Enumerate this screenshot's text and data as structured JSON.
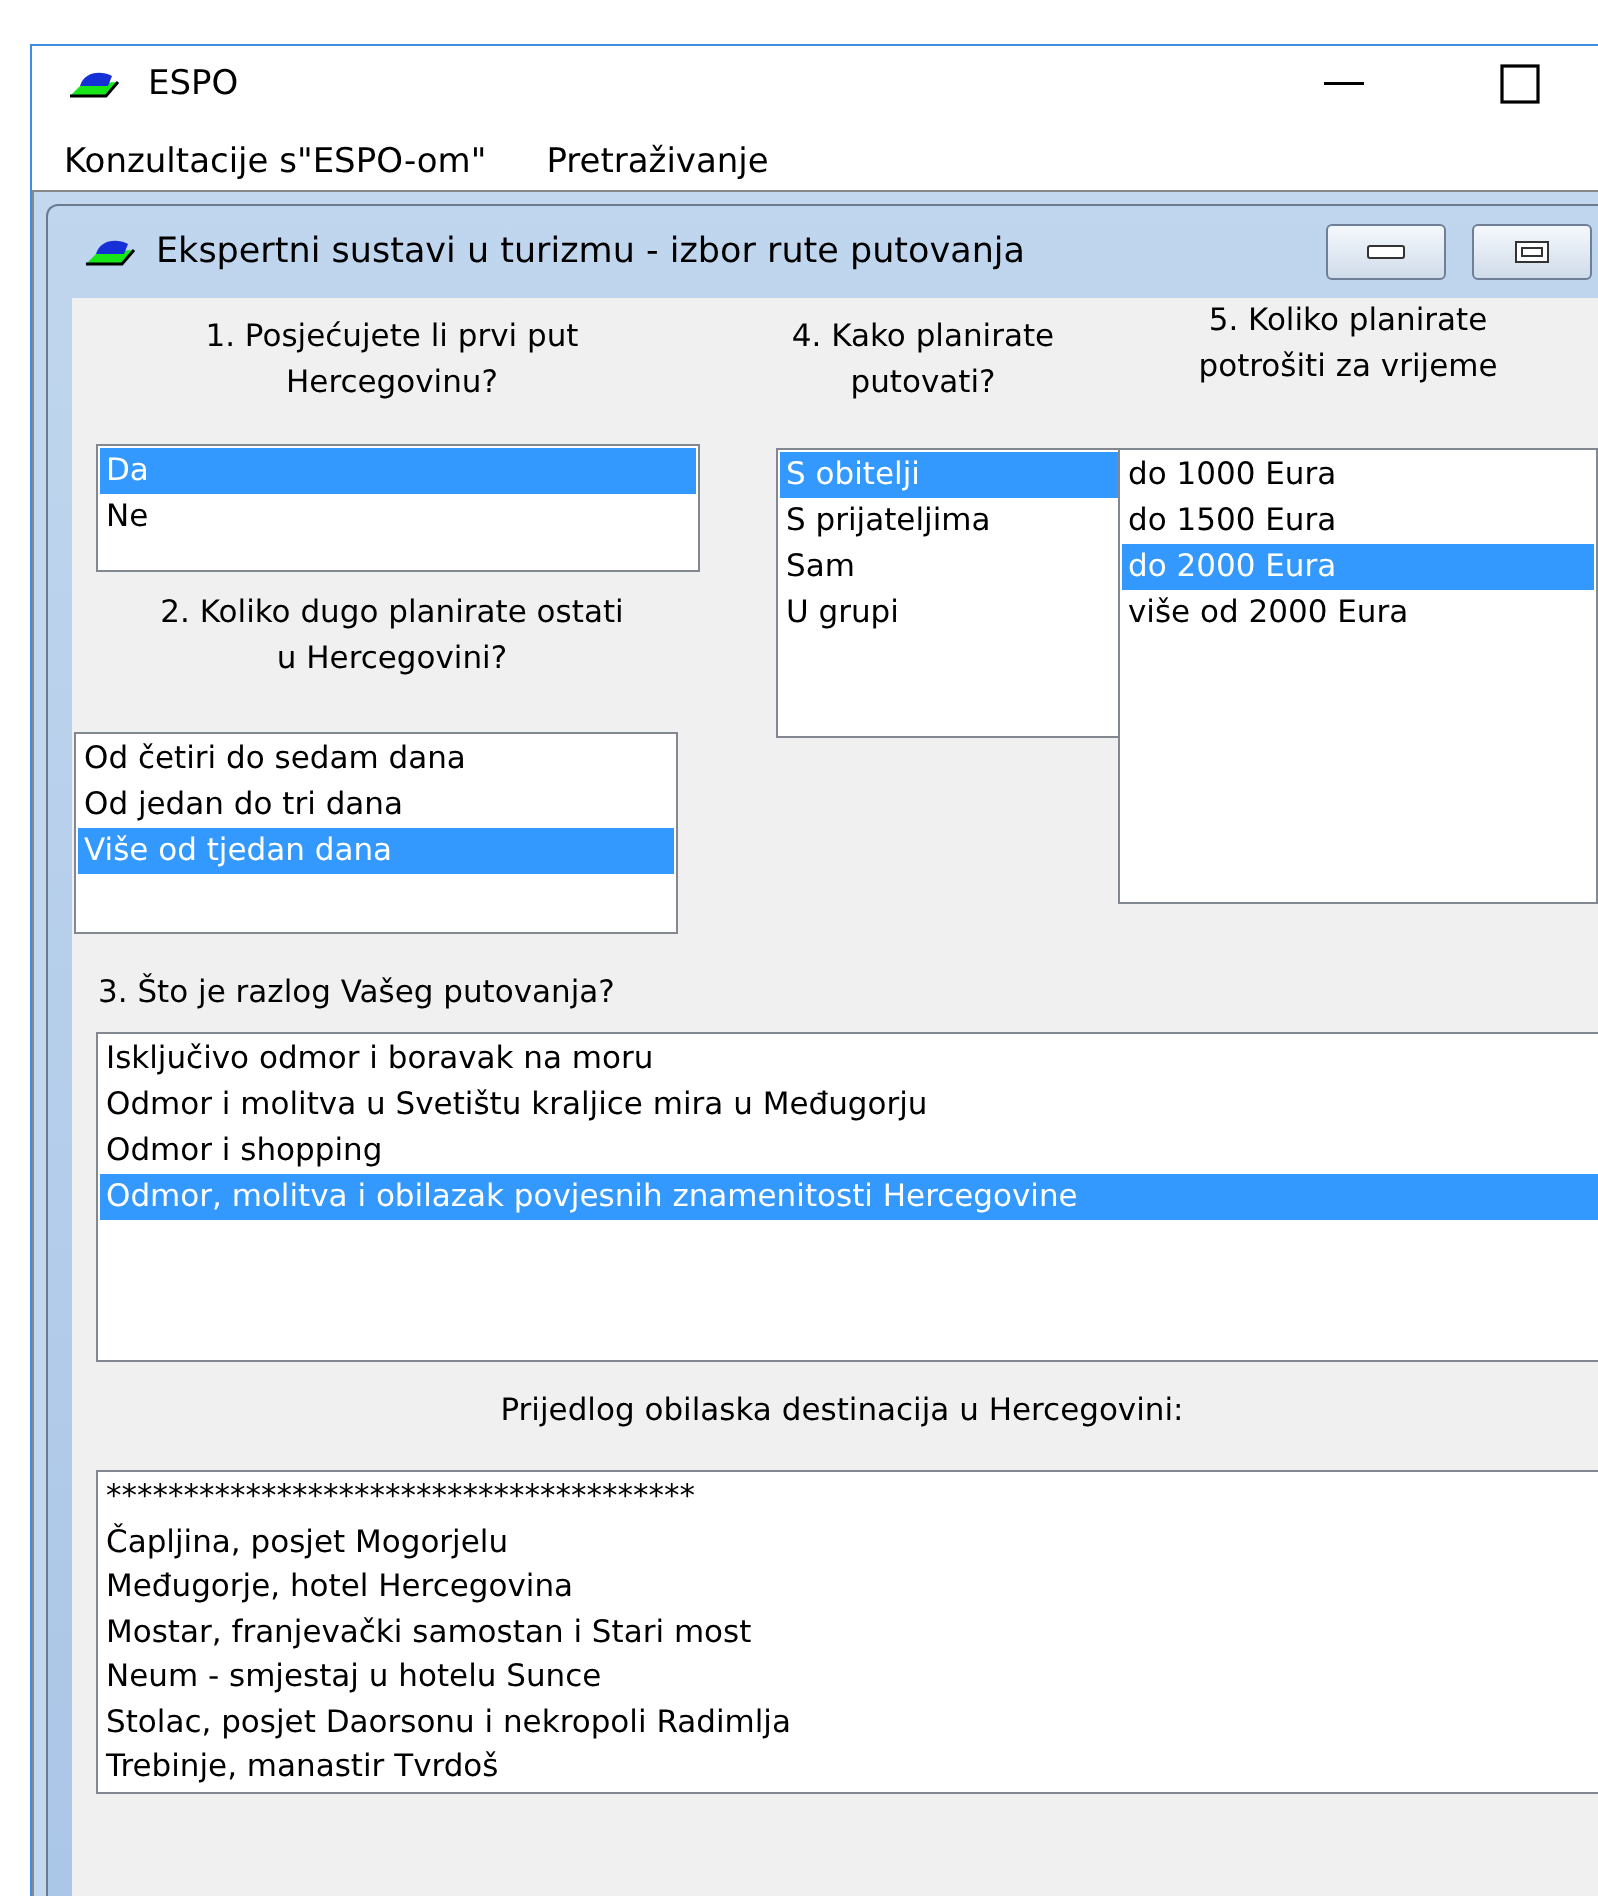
{
  "window": {
    "title": "ESPO"
  },
  "menu": [
    "Konzultacije s\"ESPO-om\"",
    "Pretraživanje"
  ],
  "child_window": {
    "title": "Ekspertni sustavi u turizmu - izbor rute putovanja"
  },
  "left_column": [
    {
      "label": "1. Posjećujete li prvi put\nHercegovinu?",
      "options": [
        {
          "text": "Da",
          "selected": true
        },
        {
          "text": "Ne",
          "selected": false
        }
      ]
    },
    {
      "label": "2. Koliko dugo planirate ostati\nu Hercegovini?",
      "options": [
        {
          "text": "Od četiri do sedam dana",
          "selected": false
        },
        {
          "text": "Od jedan do tri dana",
          "selected": false
        },
        {
          "text": "Više od tjedan dana",
          "selected": true
        }
      ]
    }
  ],
  "middle_column": {
    "label": "4. Kako planirate\nputovati?",
    "options": [
      {
        "text": "S obitelji",
        "selected": true
      },
      {
        "text": "S prijateljima",
        "selected": false
      },
      {
        "text": "Sam",
        "selected": false
      },
      {
        "text": "U grupi",
        "selected": false
      }
    ]
  },
  "right_column": {
    "label": "5. Koliko planirate\npotrošiti za vrijeme",
    "options": [
      {
        "text": "do 1000 Eura",
        "selected": false
      },
      {
        "text": "do 1500 Eura",
        "selected": false
      },
      {
        "text": "do 2000 Eura",
        "selected": true
      },
      {
        "text": "više od 2000 Eura",
        "selected": false
      }
    ]
  },
  "reason_question": {
    "label": "3. Što je razlog Vašeg putovanja?",
    "options": [
      {
        "text": "Isključivo odmor i boravak na moru",
        "selected": false
      },
      {
        "text": "Odmor i molitva u Svetištu kraljice mira u Međugorju",
        "selected": false
      },
      {
        "text": "Odmor i shopping",
        "selected": false
      },
      {
        "text": "Odmor, molitva i obilazak povjesnih znamenitosti Hercegovine",
        "selected": true
      }
    ]
  },
  "result": {
    "label": "Prijedlog obilaska destinacija u Hercegovini:",
    "lines": [
      "**************************************",
      "Čapljina, posjet Mogorjelu",
      "Međugorje, hotel Hercegovina",
      "Mostar, franjevački samostan i Stari most",
      "Neum - smjestaj u hotelu Sunce",
      "Stolac, posjet Daorsonu i nekropoli Radimlja",
      "Trebinje, manastir Tvrdoš"
    ]
  }
}
